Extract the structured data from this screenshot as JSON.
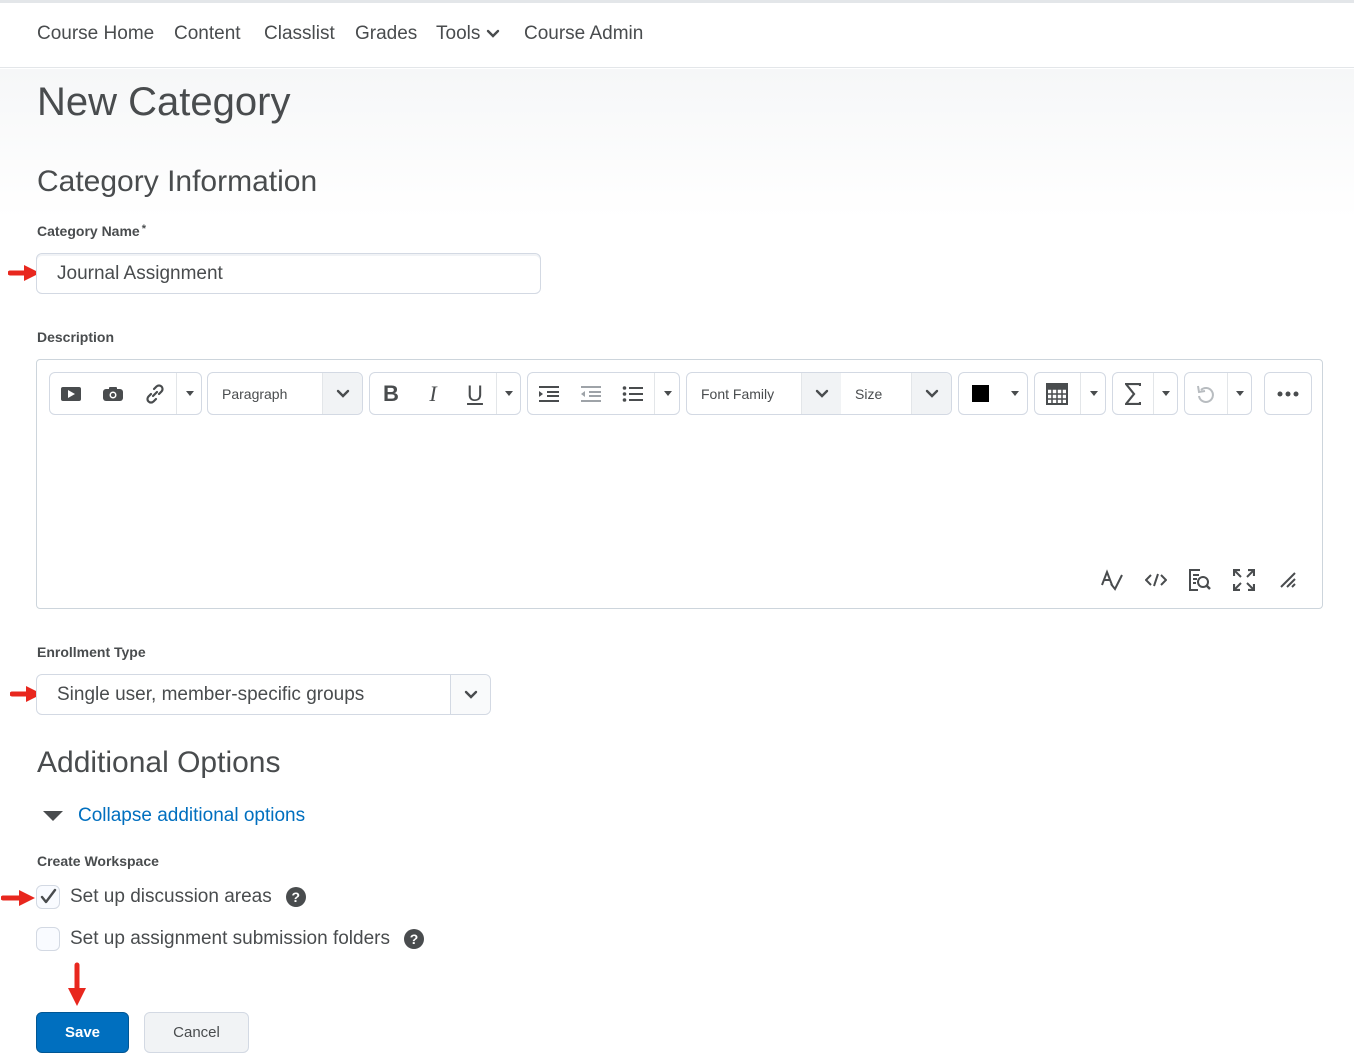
{
  "nav": {
    "items": [
      "Course Home",
      "Content",
      "Classlist",
      "Grades",
      "Tools",
      "Course Admin"
    ]
  },
  "page": {
    "title": "New Category"
  },
  "category_info": {
    "heading": "Category Information",
    "name_label": "Category Name",
    "required_mark": "*",
    "name_value": "Journal Assignment",
    "description_label": "Description"
  },
  "toolbar": {
    "block_format": "Paragraph",
    "bold": "B",
    "italic": "I",
    "underline": "U",
    "font_family": "Font Family",
    "size": "Size",
    "text_color": "#000000"
  },
  "enrollment": {
    "label": "Enrollment Type",
    "selected": "Single user, member-specific groups"
  },
  "additional": {
    "heading": "Additional Options",
    "collapse_link": "Collapse additional options",
    "workspace_label": "Create Workspace",
    "options": [
      {
        "label": "Set up discussion areas",
        "checked": true
      },
      {
        "label": "Set up assignment submission folders",
        "checked": false
      }
    ],
    "help_glyph": "?"
  },
  "buttons": {
    "save": "Save",
    "cancel": "Cancel"
  },
  "colors": {
    "primary": "#006fbf",
    "annotation_arrow": "#e8271e",
    "link": "#006fbf"
  }
}
